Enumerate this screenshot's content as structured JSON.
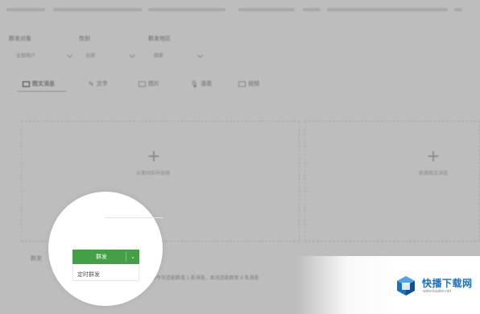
{
  "header": {
    "blurred_notice": true
  },
  "filters": {
    "group_label": "群发对象",
    "group_value": "全部用户",
    "gender_label": "性别",
    "gender_value": "全部",
    "region_label": "群发地区",
    "region_value": "国家"
  },
  "tabs": [
    {
      "label": "图文消息",
      "icon": "document-icon",
      "active": true
    },
    {
      "label": "文字",
      "icon": "pencil-icon",
      "active": false
    },
    {
      "label": "图片",
      "icon": "image-icon",
      "active": false
    },
    {
      "label": "语音",
      "icon": "microphone-icon",
      "active": false
    },
    {
      "label": "视频",
      "icon": "video-icon",
      "active": false
    }
  ],
  "cards": {
    "left_caption": "从素材库中选择",
    "right_caption": "新建图文消息"
  },
  "footer": {
    "send_label_prefix": "群发",
    "notice_text": "你今天还能群发 1 条消息，本月还能群发 4 条消息"
  },
  "send_button": {
    "label": "群发",
    "color": "#43a046"
  },
  "dropdown": {
    "option": "定时群发"
  },
  "watermark": {
    "title": "快播下载网",
    "subtitle": "www.kuaibo.net"
  },
  "colors": {
    "overlay": "#bdbdbd",
    "brand_green": "#43a046",
    "watermark_blue": "#1a6fc0"
  }
}
